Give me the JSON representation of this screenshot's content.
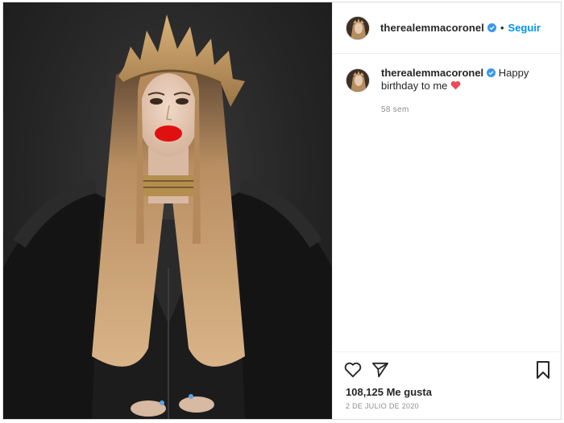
{
  "post": {
    "username": "therealemmacoronel",
    "follow_label": "Seguir",
    "separator": "•",
    "caption": {
      "username": "therealemmacoronel",
      "text": "Happy birthday to me",
      "emoji": "heart-icon",
      "time": "58 sem"
    },
    "likes": "108,125 Me gusta",
    "date": "2 de julio de 2020",
    "icons": {
      "like": "heart-outline-icon",
      "share": "paper-plane-icon",
      "save": "bookmark-icon",
      "verified": "verified-badge-icon"
    },
    "colors": {
      "accent": "#0095f6",
      "verified": "#3897f0",
      "heart": "#ed4956"
    }
  }
}
